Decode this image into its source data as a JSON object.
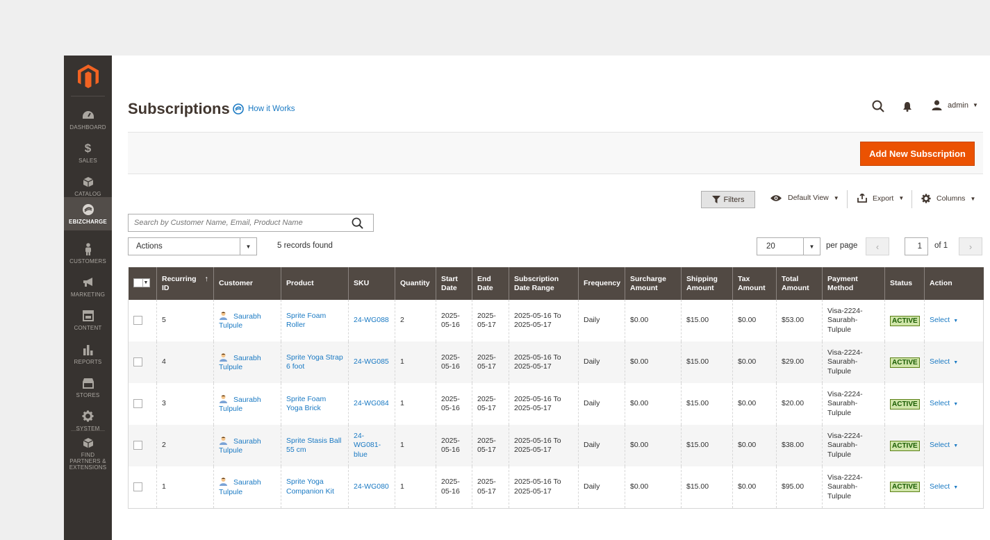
{
  "sidebar": {
    "items": [
      {
        "label": "Dashboard",
        "icon": "dashboard-icon"
      },
      {
        "label": "Sales",
        "icon": "dollar-icon"
      },
      {
        "label": "Catalog",
        "icon": "box-icon"
      },
      {
        "label": "EBizCharge",
        "icon": "ebizcharge-icon",
        "active": true
      },
      {
        "label": "Customers",
        "icon": "person-icon"
      },
      {
        "label": "Marketing",
        "icon": "megaphone-icon"
      },
      {
        "label": "Content",
        "icon": "layout-icon"
      },
      {
        "label": "Reports",
        "icon": "bar-chart-icon"
      },
      {
        "label": "Stores",
        "icon": "store-icon"
      },
      {
        "label": "System",
        "icon": "gear-icon"
      },
      {
        "label": "Find Partners & Extensions",
        "icon": "cube-icon"
      }
    ]
  },
  "header": {
    "title": "Subscriptions",
    "how_it_works": "How it Works",
    "user": "admin"
  },
  "toolbar": {
    "add_button": "Add New Subscription",
    "filters": "Filters",
    "default_view": "Default View",
    "export": "Export",
    "columns": "Columns"
  },
  "search": {
    "placeholder": "Search by Customer Name, Email, Product Name",
    "value": ""
  },
  "grid_controls": {
    "actions": "Actions",
    "records_found": "5 records found",
    "per_page_value": "20",
    "per_page_label": "per page",
    "page": "1",
    "of_pages": "of 1"
  },
  "columns": [
    "Recurring ID",
    "Customer",
    "Product",
    "SKU",
    "Quantity",
    "Start Date",
    "End Date",
    "Subscription Date Range",
    "Frequency",
    "Surcharge Amount",
    "Shipping Amount",
    "Tax Amount",
    "Total Amount",
    "Payment Method",
    "Status",
    "Action"
  ],
  "rows": [
    {
      "id": "5",
      "customer": "Saurabh Tulpule",
      "product": "Sprite Foam Roller",
      "sku": "24-WG088",
      "qty": "2",
      "start": "2025-05-16",
      "end": "2025-05-17",
      "range": "2025-05-16 To 2025-05-17",
      "frequency": "Daily",
      "surcharge": "$0.00",
      "shipping": "$15.00",
      "tax": "$0.00",
      "total": "$53.00",
      "payment": "Visa-2224-Saurabh-Tulpule",
      "status": "ACTIVE",
      "action": "Select"
    },
    {
      "id": "4",
      "customer": "Saurabh Tulpule",
      "product": "Sprite Yoga Strap 6 foot",
      "sku": "24-WG085",
      "qty": "1",
      "start": "2025-05-16",
      "end": "2025-05-17",
      "range": "2025-05-16 To 2025-05-17",
      "frequency": "Daily",
      "surcharge": "$0.00",
      "shipping": "$15.00",
      "tax": "$0.00",
      "total": "$29.00",
      "payment": "Visa-2224-Saurabh-Tulpule",
      "status": "ACTIVE",
      "action": "Select"
    },
    {
      "id": "3",
      "customer": "Saurabh Tulpule",
      "product": "Sprite Foam Yoga Brick",
      "sku": "24-WG084",
      "qty": "1",
      "start": "2025-05-16",
      "end": "2025-05-17",
      "range": "2025-05-16 To 2025-05-17",
      "frequency": "Daily",
      "surcharge": "$0.00",
      "shipping": "$15.00",
      "tax": "$0.00",
      "total": "$20.00",
      "payment": "Visa-2224-Saurabh-Tulpule",
      "status": "ACTIVE",
      "action": "Select"
    },
    {
      "id": "2",
      "customer": "Saurabh Tulpule",
      "product": "Sprite Stasis Ball 55 cm",
      "sku": "24-WG081-blue",
      "qty": "1",
      "start": "2025-05-16",
      "end": "2025-05-17",
      "range": "2025-05-16 To 2025-05-17",
      "frequency": "Daily",
      "surcharge": "$0.00",
      "shipping": "$15.00",
      "tax": "$0.00",
      "total": "$38.00",
      "payment": "Visa-2224-Saurabh-Tulpule",
      "status": "ACTIVE",
      "action": "Select"
    },
    {
      "id": "1",
      "customer": "Saurabh Tulpule",
      "product": "Sprite Yoga Companion Kit",
      "sku": "24-WG080",
      "qty": "1",
      "start": "2025-05-16",
      "end": "2025-05-17",
      "range": "2025-05-16 To 2025-05-17",
      "frequency": "Daily",
      "surcharge": "$0.00",
      "shipping": "$15.00",
      "tax": "$0.00",
      "total": "$95.00",
      "payment": "Visa-2224-Saurabh-Tulpule",
      "status": "ACTIVE",
      "action": "Select"
    }
  ],
  "colors": {
    "accent": "#eb5202",
    "sidebar": "#373330",
    "table_header": "#514943",
    "link": "#1979c3",
    "active_badge": "#d0e5a9"
  }
}
